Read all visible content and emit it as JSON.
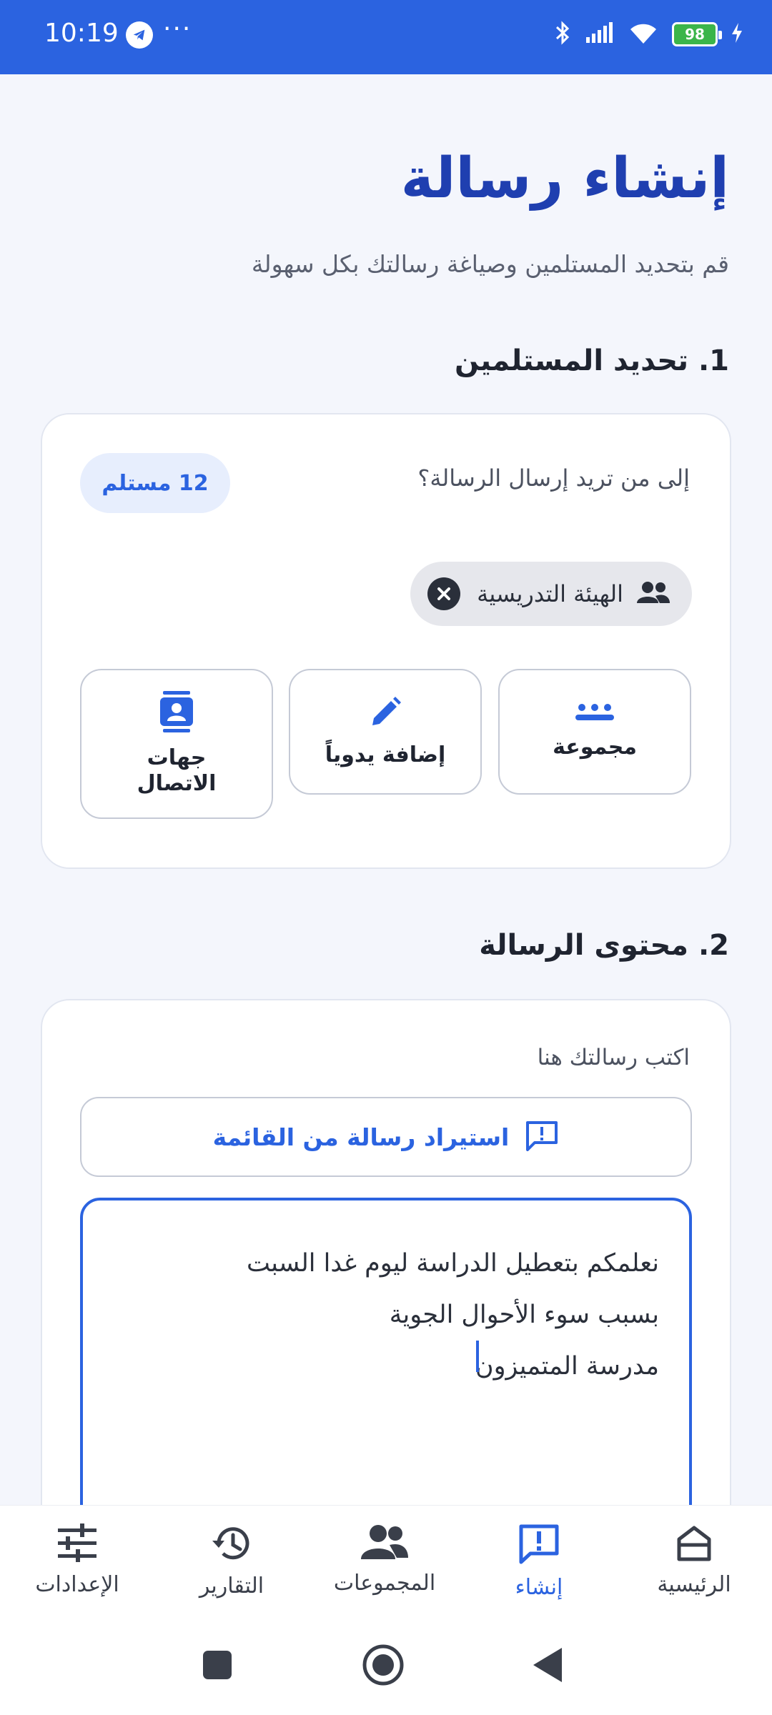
{
  "status_bar": {
    "time": "10:19",
    "dots": "···",
    "battery": "98"
  },
  "header": {
    "title": "إنشاء رسالة",
    "subtitle": "قم بتحديد المستلمين وصياغة رسالتك بكل سهولة"
  },
  "recipients": {
    "section_title": "1. تحديد المستلمين",
    "question": "إلى من تريد إرسال الرسالة؟",
    "count_badge": "12 مستلم",
    "chip_label": "الهيئة التدريسية",
    "options": [
      {
        "label": "مجموعة",
        "icon": "group-dots-icon"
      },
      {
        "label": "إضافة يدوياً",
        "icon": "pencil-icon"
      },
      {
        "label": "جهات الاتصال",
        "icon": "contacts-icon"
      }
    ]
  },
  "message": {
    "section_title": "2. محتوى الرسالة",
    "hint": "اكتب رسالتك هنا",
    "import_label": "استيراد رسالة من القائمة",
    "lines": [
      "نعلمكم بتعطيل الدراسة ليوم غدا السبت",
      "بسبب سوء الأحوال الجوية",
      "مدرسة المتميزون"
    ]
  },
  "bottom_nav": {
    "items": [
      {
        "label": "الرئيسية",
        "icon": "home-icon",
        "active": false
      },
      {
        "label": "إنشاء",
        "icon": "create-message-icon",
        "active": true
      },
      {
        "label": "المجموعات",
        "icon": "groups-icon",
        "active": false
      },
      {
        "label": "التقارير",
        "icon": "history-icon",
        "active": false
      },
      {
        "label": "الإعدادات",
        "icon": "settings-sliders-icon",
        "active": false
      }
    ]
  },
  "colors": {
    "accent": "#2B63E0",
    "title": "#1F3FB0",
    "background": "#F4F6FC"
  }
}
